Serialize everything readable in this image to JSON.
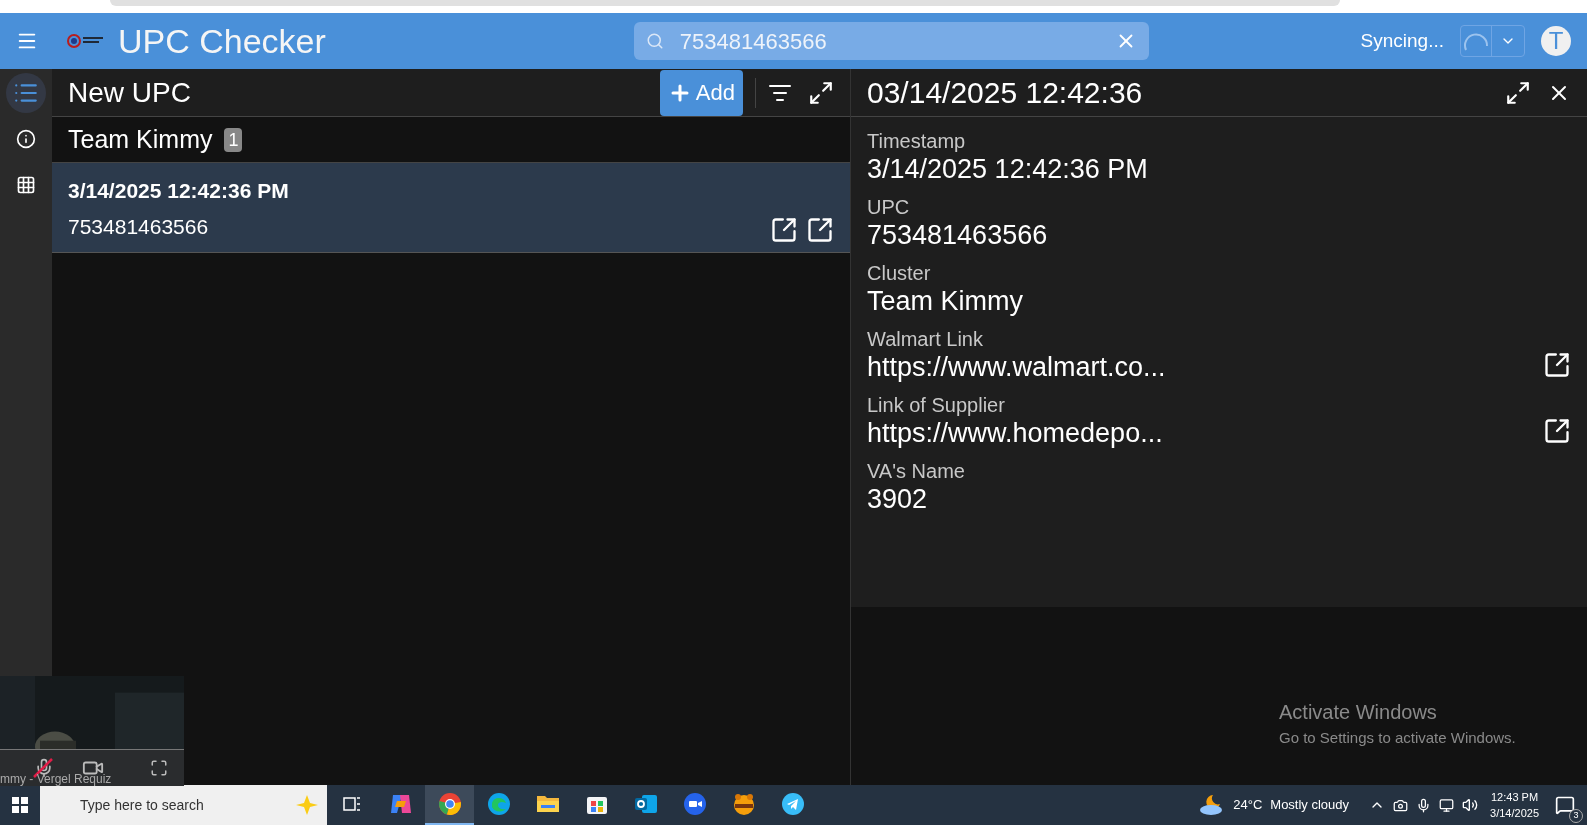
{
  "header": {
    "app_title": "UPC Checker",
    "search": {
      "value": "753481463566"
    },
    "sync_status": "Syncing...",
    "avatar": "T"
  },
  "rail": [
    {
      "kind": "list",
      "selected": true
    },
    {
      "kind": "info",
      "selected": false
    },
    {
      "kind": "grid",
      "selected": false
    }
  ],
  "list_panel": {
    "title": "New UPC",
    "add_button": "Add",
    "group": {
      "name": "Team Kimmy",
      "count": "1"
    },
    "items": [
      {
        "timestamp": "3/14/2025 12:42:36 PM",
        "upc": "753481463566",
        "selected": true
      }
    ]
  },
  "detail_panel": {
    "title": "03/14/2025 12:42:36",
    "fields": [
      {
        "label": "Timestamp",
        "value": "3/14/2025 12:42:36 PM",
        "link": false
      },
      {
        "label": "UPC",
        "value": "753481463566",
        "link": false
      },
      {
        "label": "Cluster",
        "value": "Team Kimmy",
        "link": false
      },
      {
        "label": "Walmart Link",
        "value": "https://www.walmart.co...",
        "link": true
      },
      {
        "label": "Link of Supplier",
        "value": "https://www.homedepo...",
        "link": true
      },
      {
        "label": "VA's Name",
        "value": "3902",
        "link": false
      }
    ]
  },
  "video_overlay": {
    "caption": "mmy - Vergel Requiz",
    "mic_muted": true
  },
  "activation_notice": {
    "title": "Activate Windows",
    "subtitle": "Go to Settings to activate Windows."
  },
  "taskbar": {
    "search": {
      "placeholder": "Type here to search"
    },
    "apps": [
      {
        "kind": "taskview",
        "selected": false
      },
      {
        "kind": "copilot",
        "selected": false
      },
      {
        "kind": "chrome",
        "selected": true
      },
      {
        "kind": "edge",
        "selected": false
      },
      {
        "kind": "explorer",
        "selected": false
      },
      {
        "kind": "store",
        "selected": false
      },
      {
        "kind": "outlook",
        "selected": false
      },
      {
        "kind": "zoom",
        "selected": false
      },
      {
        "kind": "game",
        "selected": false
      },
      {
        "kind": "telegram",
        "selected": false
      }
    ],
    "weather": {
      "temperature": "24°C",
      "condition": "Mostly cloudy"
    },
    "time": "12:43 PM",
    "date": "3/14/2025",
    "notifications": "3"
  }
}
